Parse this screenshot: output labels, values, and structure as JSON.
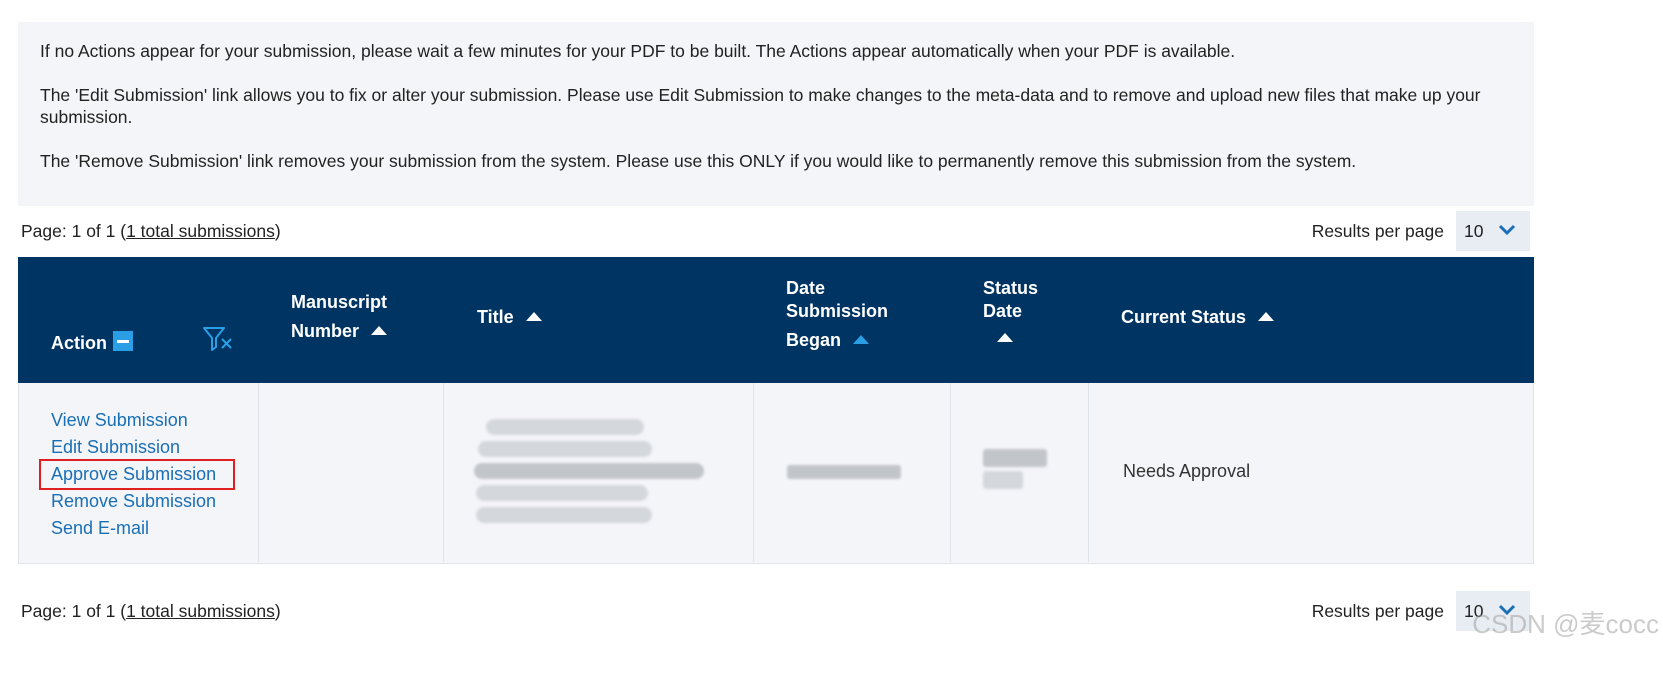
{
  "info": {
    "line1": "If no Actions appear for your submission, please wait a few minutes for your PDF to be built. The Actions appear automatically when your PDF is available.",
    "line2": "The 'Edit Submission' link allows you to fix or alter your submission. Please use Edit Submission to make changes to the meta-data and to remove and upload new files that make up your submission.",
    "line3": "The 'Remove Submission' link removes your submission from the system. Please use this ONLY if you would like to permanently remove this submission from the system."
  },
  "pager": {
    "page_prefix": "Page: 1 of 1 (",
    "total_link": "1 total submissions",
    "page_suffix": ")",
    "rpp_label": "Results per page",
    "rpp_value": "10"
  },
  "table": {
    "headers": {
      "action": "Action",
      "manuscript_line1": "Manuscript",
      "manuscript_line2": "Number",
      "title": "Title",
      "date_line1": "Date",
      "date_line2": "Submission",
      "date_line3": "Began",
      "status_date_line1": "Status",
      "status_date_line2": "Date",
      "current_status": "Current Status"
    },
    "row": {
      "actions": [
        "View Submission",
        "Edit Submission",
        "Approve Submission",
        "Remove Submission",
        "Send E-mail"
      ],
      "current_status": "Needs Approval"
    }
  },
  "colors": {
    "header_bg": "#003462",
    "link": "#1a6fb5",
    "accent": "#2a9fe6",
    "highlight_box": "#e02020"
  },
  "watermark": "CSDN @麦cocc"
}
